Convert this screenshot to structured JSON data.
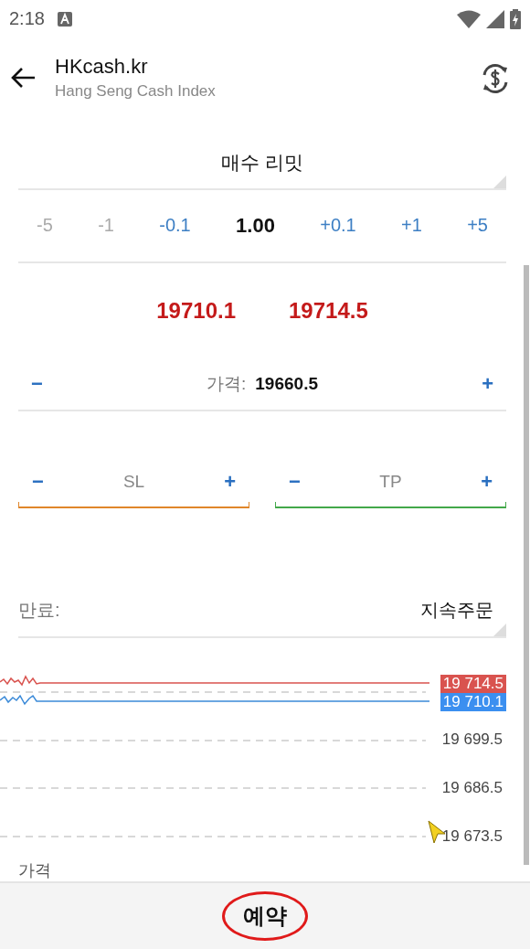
{
  "status_bar": {
    "time": "2:18"
  },
  "header": {
    "title": "HKcash.kr",
    "subtitle": "Hang Seng Cash Index"
  },
  "order_type": {
    "value": "매수 리밋"
  },
  "volume": {
    "value": "1.00",
    "steps_down": [
      {
        "label": "-5",
        "disabled": true
      },
      {
        "label": "-1",
        "disabled": true
      },
      {
        "label": "-0.1",
        "disabled": false
      }
    ],
    "steps_up": [
      {
        "label": "+0.1",
        "disabled": false
      },
      {
        "label": "+1",
        "disabled": false
      },
      {
        "label": "+5",
        "disabled": false
      }
    ]
  },
  "quotes": [
    {
      "value": "19710.1"
    },
    {
      "value": "19714.5"
    }
  ],
  "price": {
    "minus": "−",
    "label": "가격:",
    "value": "19660.5",
    "plus": "+"
  },
  "stops": [
    {
      "label": "SL",
      "minus": "−",
      "plus": "+",
      "color": "#e0862a"
    },
    {
      "label": "TP",
      "minus": "−",
      "plus": "+",
      "color": "#43a84a"
    }
  ],
  "expiry": {
    "label": "만료:",
    "value": "지속주문"
  },
  "chart": {
    "ask_label": "19 714.5",
    "bid_label": "19 710.1",
    "axis_labels": [
      "19 699.5",
      "19 686.5",
      "19 673.5"
    ],
    "caption": "가격"
  },
  "action": {
    "label": "예약"
  }
}
